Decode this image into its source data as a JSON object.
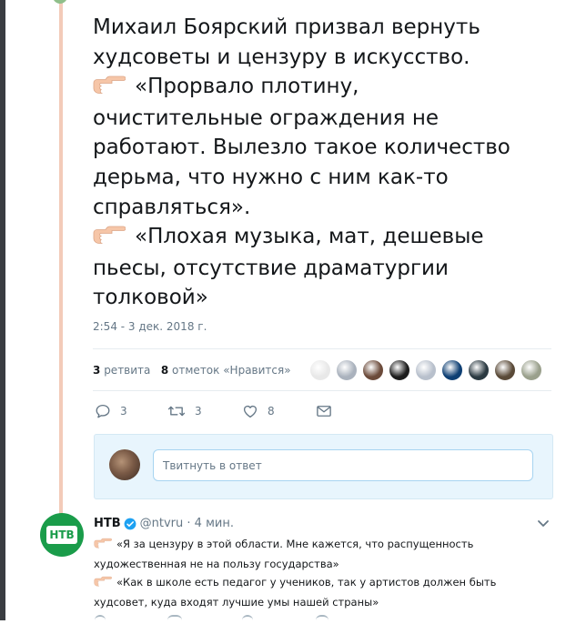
{
  "tweet": {
    "lines": [
      {
        "text": "Михаил Боярский призвал вернуть"
      },
      {
        "text": "худсоветы и цензуру в искусство."
      },
      {
        "hand": true,
        "text": "«Прорвало плотину,"
      },
      {
        "text": "очистительные ограждения не"
      },
      {
        "text": "работают. Вылезло такое количество"
      },
      {
        "text": "дерьма, что нужно с ним как-то"
      },
      {
        "text": "справляться»."
      },
      {
        "hand": true,
        "text": "«Плохая музыка, мат, дешевые"
      },
      {
        "text": "пьесы, отсутствие драматургии"
      },
      {
        "text": "толковой»"
      }
    ],
    "timestamp": "2:54 - 3 дек. 2018 г.",
    "stats": {
      "retweet_count": "3",
      "retweet_label": "ретвита",
      "like_count": "8",
      "like_label": "отметок «Нравится»"
    },
    "liker_avatar_colors": [
      "#e8e8e8",
      "#aab2bd",
      "#6b4a3a",
      "#1d1d1d",
      "#b8c0cc",
      "#0e3f73",
      "#2b3a42",
      "#5a4a38",
      "#9aa08c"
    ],
    "actions": {
      "reply_count": "3",
      "retweet_count": "3",
      "like_count": "8"
    }
  },
  "reply_box": {
    "placeholder": "Твитнуть в ответ"
  },
  "reply": {
    "avatar_text": "НТВ",
    "name": "НТВ",
    "handle": "@ntvru",
    "time": "· 4 мин.",
    "lines": [
      {
        "hand": true,
        "text": "«Я за цензуру в этой области. Мне кажется, что распущенность"
      },
      {
        "text": "художественная не на пользу государства»"
      },
      {
        "hand": true,
        "text": "«Как в школе есть педагог у учеников, так у артистов должен быть"
      },
      {
        "text": "худсовет, куда входят лучшие умы нашей страны»"
      }
    ]
  },
  "colors": {
    "thread_line": "#f3cbb9",
    "accent": "#1da1f2",
    "ntv_green": "#1a9c4a",
    "muted": "#657786",
    "text": "#14171a"
  }
}
